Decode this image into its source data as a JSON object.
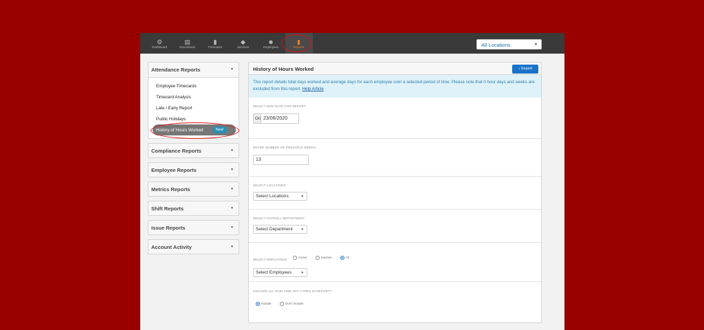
{
  "nav": {
    "items": [
      {
        "label": "Dashboard",
        "icon": "dashboard-icon"
      },
      {
        "label": "Documents",
        "icon": "documents-icon"
      },
      {
        "label": "Forecasts",
        "icon": "forecasts-icon"
      },
      {
        "label": "Services",
        "icon": "services-icon"
      },
      {
        "label": "Employees",
        "icon": "employees-icon"
      },
      {
        "label": "Reports",
        "icon": "reports-icon",
        "active": true
      }
    ],
    "location_select": "All Locations"
  },
  "sidebar": {
    "attendance": {
      "title": "Attendance Reports",
      "items": [
        "Employee Timecards",
        "Timecard Analysis",
        "Late / Early Report",
        "Public Holidays"
      ],
      "selected": "History of Hours Worked",
      "badge": "New!"
    },
    "sections": [
      "Compliance Reports",
      "Employee Reports",
      "Metrics Reports",
      "Shift Reports",
      "Issue Reports",
      "Account Activity"
    ]
  },
  "main": {
    "title": "History of Hours Worked",
    "export_label": "Export",
    "info_text": "This report details total days worked and average days for each employee over a selected period of time. Please note that 0 hour days and weeks are excluded from this report.",
    "info_link": "Help Article",
    "end_date": {
      "label": "Select end date for report",
      "prefix": "On",
      "value": "23/06/2020"
    },
    "weeks": {
      "label": "Enter number of previous weeks",
      "value": "13"
    },
    "locations": {
      "label": "Select locations",
      "value": "Select Locations"
    },
    "department": {
      "label": "Select payroll department",
      "value": "Select Department"
    },
    "employees": {
      "label": "Select employees",
      "options": [
        "Active",
        "Inactive",
        "All"
      ],
      "selected": "All",
      "value": "Select Employees"
    },
    "paid_time_off": {
      "label": "Include all paid time off types in report?",
      "options": [
        "Include",
        "Don't Include"
      ],
      "selected": "Include"
    }
  },
  "colors": {
    "background": "#990000",
    "accent": "#1a73c9",
    "active_nav": "#f07a2c",
    "highlight_ring": "#e01010"
  }
}
